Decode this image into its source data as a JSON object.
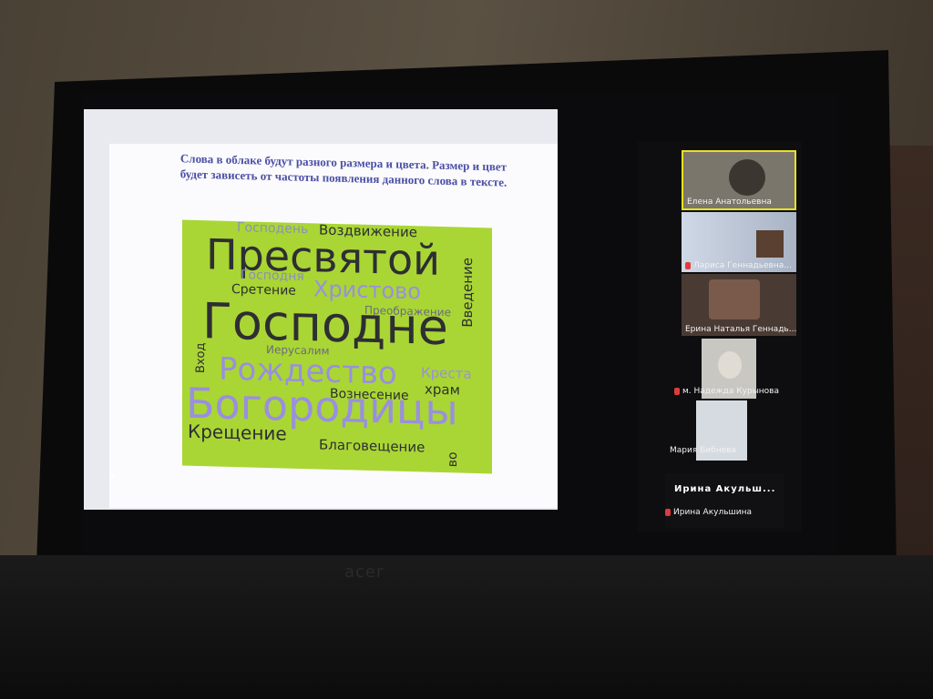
{
  "slide": {
    "text": "Слова в облаке будут разного размера и цвета. Размер и цвет будет зависеть от частоты появления данного слова в тексте.",
    "cloud_color": "#a9d634",
    "words": [
      {
        "text": "Господень"
      },
      {
        "text": "Воздвижение"
      },
      {
        "text": "Пресвятой"
      },
      {
        "text": "Господня"
      },
      {
        "text": "Сретение"
      },
      {
        "text": "Христово"
      },
      {
        "text": "Введение"
      },
      {
        "text": "Преображение"
      },
      {
        "text": "Господне"
      },
      {
        "text": "Вход"
      },
      {
        "text": "Иерусалим"
      },
      {
        "text": "Рождество"
      },
      {
        "text": "Креста"
      },
      {
        "text": "Вознесение"
      },
      {
        "text": "храм"
      },
      {
        "text": "Богородицы"
      },
      {
        "text": "Крещение"
      },
      {
        "text": "Благовещение"
      },
      {
        "text": "во"
      }
    ]
  },
  "participants": [
    {
      "name": "Елена Анатольевна",
      "active": true,
      "muted": false
    },
    {
      "name": "Лариса Геннадьевна...",
      "active": false,
      "muted": true
    },
    {
      "name": "Ерина Наталья Геннадь...",
      "active": false,
      "muted": false
    },
    {
      "name": "м. Надежда Курынова",
      "active": false,
      "muted": true
    },
    {
      "name": "Мария Бибнева",
      "active": false,
      "muted": false
    },
    {
      "name": "Ирина Акульш...",
      "active": false,
      "muted": false,
      "caption": "Ирина Акульшина",
      "caption_muted": true
    }
  ],
  "laptop": {
    "brand": "acer"
  }
}
